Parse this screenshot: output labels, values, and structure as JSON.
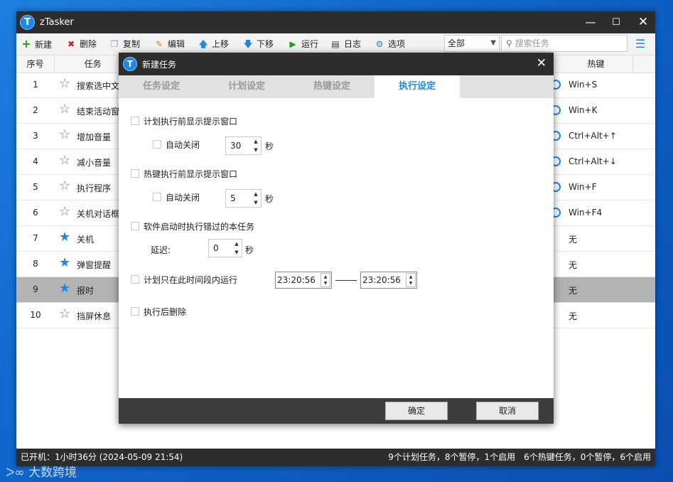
{
  "window": {
    "title": "zTasker",
    "logo": "T"
  },
  "toolbar": {
    "new": "新建",
    "delete": "删除",
    "copy": "复制",
    "edit": "编辑",
    "up": "上移",
    "down": "下移",
    "run": "运行",
    "log": "日志",
    "options": "选项",
    "filter_value": "全部",
    "search_placeholder": "搜索任务"
  },
  "table": {
    "col_index": "序号",
    "col_task": "任务",
    "col_hotkey": "热键",
    "rows": [
      {
        "n": "1",
        "name": "搜索选中文",
        "star": false,
        "radio": true,
        "hotkey": "Win+S"
      },
      {
        "n": "2",
        "name": "结束活动窗",
        "star": false,
        "radio": true,
        "hotkey": "Win+K"
      },
      {
        "n": "3",
        "name": "增加音量",
        "star": false,
        "radio": true,
        "hotkey": "Ctrl+Alt+↑"
      },
      {
        "n": "4",
        "name": "减小音量",
        "star": false,
        "radio": true,
        "hotkey": "Ctrl+Alt+↓"
      },
      {
        "n": "5",
        "name": "执行程序",
        "star": false,
        "radio": true,
        "hotkey": "Win+F"
      },
      {
        "n": "6",
        "name": "关机对话框",
        "star": false,
        "radio": true,
        "hotkey": "Win+F4"
      },
      {
        "n": "7",
        "name": "关机",
        "star": true,
        "radio": false,
        "hotkey": "无"
      },
      {
        "n": "8",
        "name": "弹窗提醒",
        "star": true,
        "radio": false,
        "hotkey": "无"
      },
      {
        "n": "9",
        "name": "报时",
        "star": true,
        "radio": false,
        "hotkey": "无",
        "selected": true
      },
      {
        "n": "10",
        "name": "挡屏休息",
        "star": false,
        "radio": false,
        "hotkey": "无"
      }
    ]
  },
  "status": {
    "uptime": "已开机：1小时36分 (2024-05-09 21:54)",
    "summary": "9个计划任务，8个暂停，1个启用　6个热键任务，0个暂停，6个启用"
  },
  "dialog": {
    "title": "新建任务",
    "tabs": [
      "任务设定",
      "计划设定",
      "热键设定",
      "执行设定"
    ],
    "active_tab": 3,
    "opt1": "计划执行前显示提示窗口",
    "opt1_auto": "自动关闭",
    "opt1_value": "30",
    "opt2": "热键执行前显示提示窗口",
    "opt2_auto": "自动关闭",
    "opt2_value": "5",
    "unit_sec": "秒",
    "opt3": "软件启动时执行错过的本任务",
    "delay_label": "延迟:",
    "delay_value": "0",
    "opt4": "计划只在此时间段内运行",
    "time_start": "23:20:56",
    "time_end": "23:20:56",
    "opt5": "执行后删除",
    "ok": "确定",
    "cancel": "取消"
  },
  "watermark": "大数跨境",
  "colors": {
    "accent": "#1e88e5",
    "titlebar": "#2d2d2d",
    "selected_row": "#b3b3b3"
  }
}
